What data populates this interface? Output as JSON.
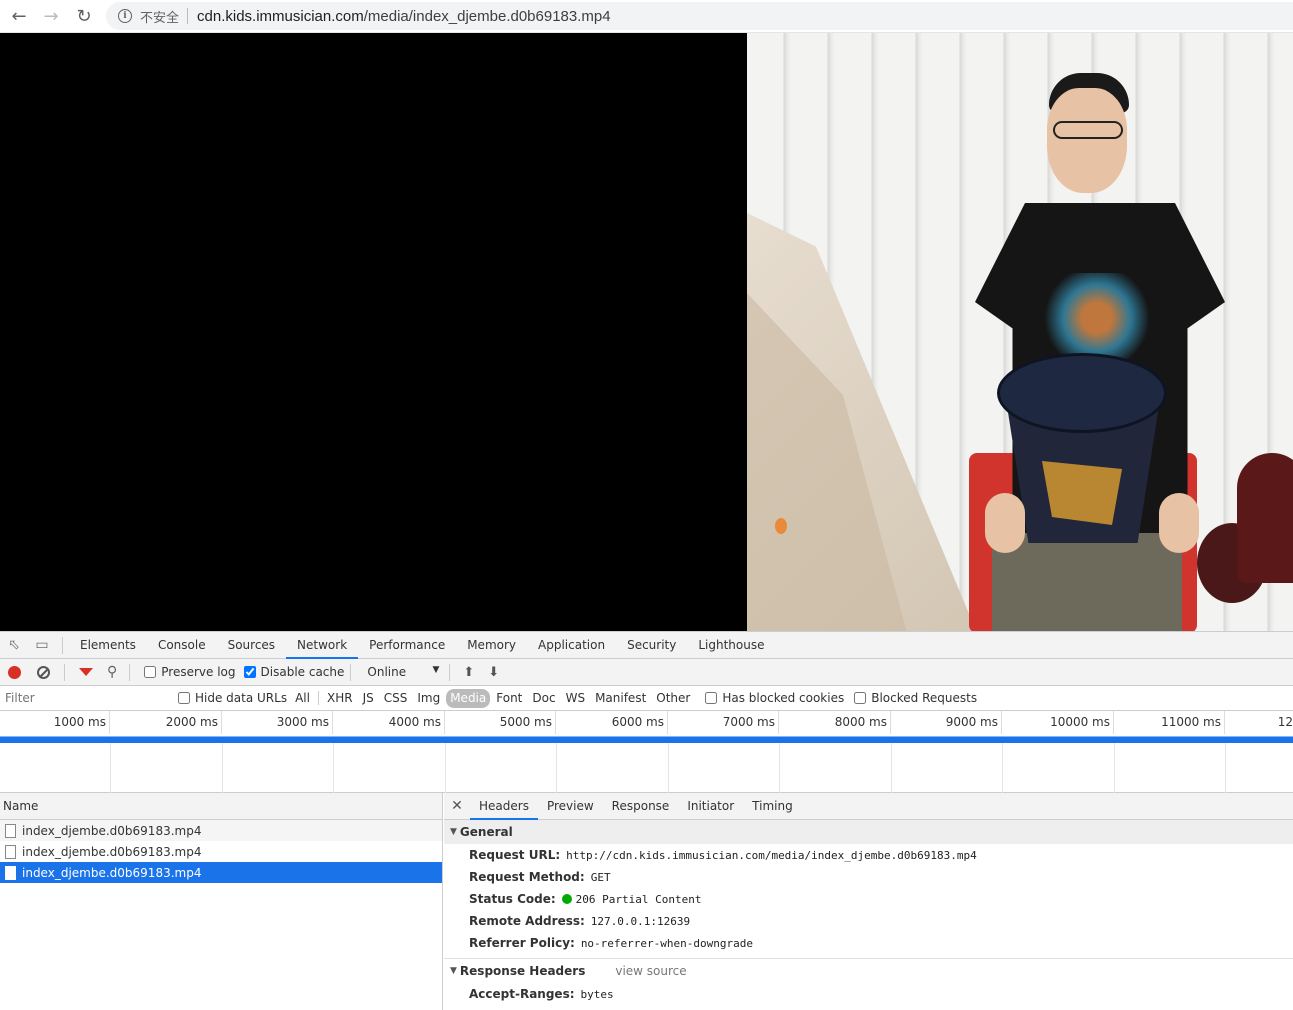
{
  "browser": {
    "security_label": "不安全",
    "url_host": "cdn.kids.immusician.com",
    "url_path": "/media/index_djembe.d0b69183.mp4"
  },
  "devtools": {
    "tabs": [
      "Elements",
      "Console",
      "Sources",
      "Network",
      "Performance",
      "Memory",
      "Application",
      "Security",
      "Lighthouse"
    ],
    "active_tab": "Network",
    "toolbar": {
      "preserve_log": "Preserve log",
      "disable_cache": "Disable cache",
      "throttle": "Online"
    },
    "filter": {
      "placeholder": "Filter",
      "hide_data_urls": "Hide data URLs",
      "types": [
        "All",
        "XHR",
        "JS",
        "CSS",
        "Img",
        "Media",
        "Font",
        "Doc",
        "WS",
        "Manifest",
        "Other"
      ],
      "active_type": "Media",
      "has_blocked_cookies": "Has blocked cookies",
      "blocked_requests": "Blocked Requests"
    },
    "timeline_ticks": [
      "1000 ms",
      "2000 ms",
      "3000 ms",
      "4000 ms",
      "5000 ms",
      "6000 ms",
      "7000 ms",
      "8000 ms",
      "9000 ms",
      "10000 ms",
      "11000 ms",
      "12"
    ],
    "list": {
      "header": "Name",
      "rows": [
        "index_djembe.d0b69183.mp4",
        "index_djembe.d0b69183.mp4",
        "index_djembe.d0b69183.mp4"
      ]
    },
    "detail": {
      "tabs": [
        "Headers",
        "Preview",
        "Response",
        "Initiator",
        "Timing"
      ],
      "general_title": "General",
      "general": [
        {
          "k": "Request URL:",
          "v": "http://cdn.kids.immusician.com/media/index_djembe.d0b69183.mp4"
        },
        {
          "k": "Request Method:",
          "v": "GET"
        },
        {
          "k": "Status Code:",
          "v": "206 Partial Content"
        },
        {
          "k": "Remote Address:",
          "v": "127.0.0.1:12639"
        },
        {
          "k": "Referrer Policy:",
          "v": "no-referrer-when-downgrade"
        }
      ],
      "response_headers_title": "Response Headers",
      "view_source": "view source",
      "response_headers": [
        {
          "k": "Accept-Ranges:",
          "v": "bytes"
        }
      ]
    }
  }
}
